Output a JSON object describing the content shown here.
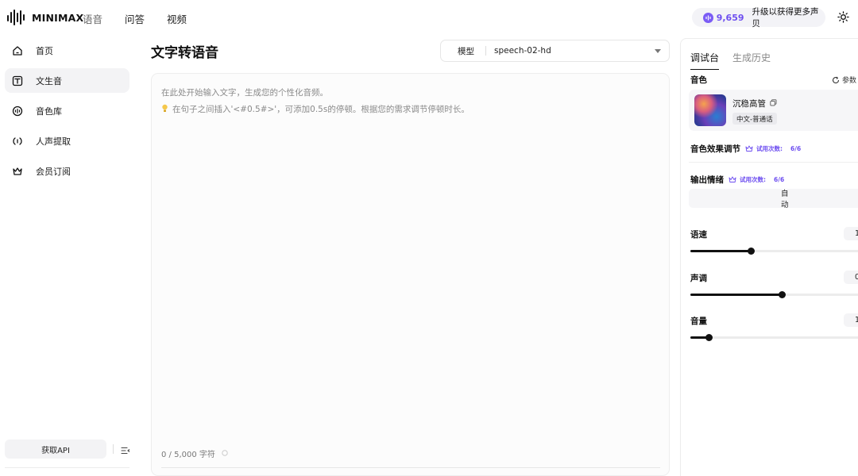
{
  "header": {
    "logo_text": "MINIMAX",
    "nav": [
      "语音",
      "问答",
      "视频"
    ],
    "credits": "9,659",
    "upgrade_label": "升级以获得更多声贝"
  },
  "sidebar": {
    "items": [
      {
        "label": "首页",
        "icon": "home-icon"
      },
      {
        "label": "文生音",
        "icon": "text-to-speech-icon"
      },
      {
        "label": "音色库",
        "icon": "voice-library-icon"
      },
      {
        "label": "人声提取",
        "icon": "voice-extract-icon"
      },
      {
        "label": "会员订阅",
        "icon": "crown-icon"
      }
    ],
    "active_index": 1,
    "api_label": "获取API"
  },
  "main": {
    "title": "文字转语音",
    "model_label": "模型",
    "model_value": "speech-02-hd",
    "placeholder_line1": "在此处开始输入文字，生成您的个性化音频。",
    "placeholder_line2": "在句子之间插入'<#0.5#>'，可添加0.5s的停顿。根据您的需求调节停顿时长。",
    "counter": "0 / 5,000 字符"
  },
  "panel": {
    "tabs": [
      "调试台",
      "生成历史"
    ],
    "active_tab": 0,
    "voice_label": "音色",
    "reset_label": "参数",
    "voice_name": "沉稳高管",
    "voice_tag": "中文-普通话",
    "effect_label": "音色效果调节",
    "trial_label": "试用次数:",
    "trial_count": "6/6",
    "emotion_label": "输出情绪",
    "emotion_value": "自动",
    "sliders": [
      {
        "label": "语速",
        "shown": "1",
        "fraction": 0.33
      },
      {
        "label": "声调",
        "shown": "0",
        "fraction": 0.5
      },
      {
        "label": "音量",
        "shown": "1",
        "fraction": 0.1
      }
    ],
    "accent_color": "#6e4ff0"
  }
}
